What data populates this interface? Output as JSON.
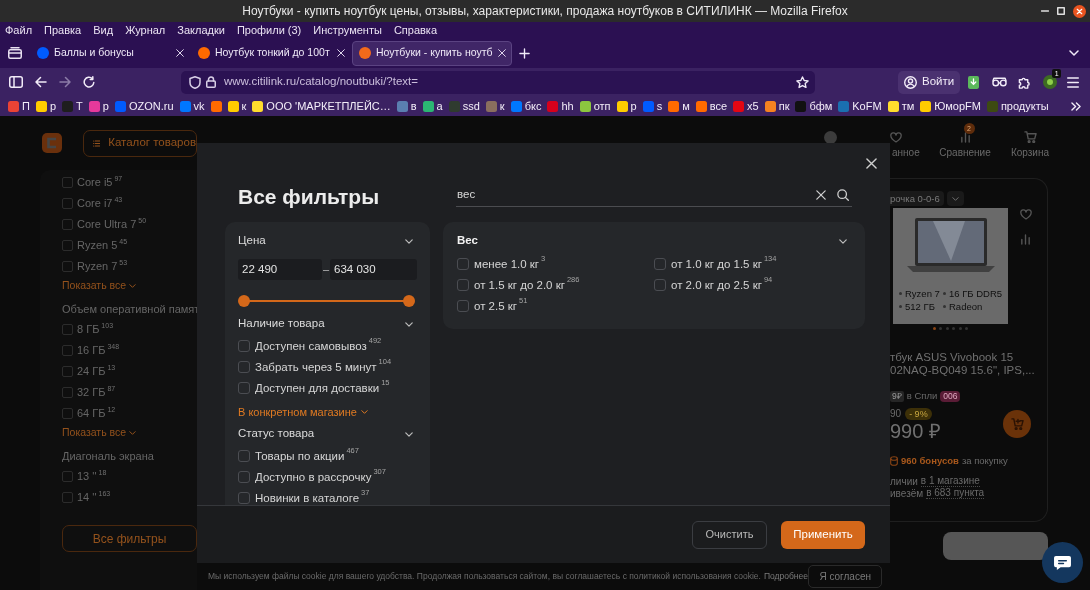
{
  "window": {
    "title": "Ноутбуки - купить ноутбук цены, отзывы, характеристики, продажа ноутбуков в СИТИЛИНК — Mozilla Firefox"
  },
  "menu_bar": [
    "Файл",
    "Правка",
    "Вид",
    "Журнал",
    "Закладки",
    "Профили (3)",
    "Инструменты",
    "Справка"
  ],
  "tabs": [
    {
      "label": "Баллы и бонусы",
      "color": "#005bff",
      "selected": false
    },
    {
      "label": "Ноутбук тонкий до 100т",
      "color": "#ff6a00",
      "selected": false
    },
    {
      "label": "Ноутбуки - купить ноутб",
      "color": "#f26a1b",
      "selected": true
    }
  ],
  "toolbar": {
    "url": "www.citilink.ru/catalog/noutbuki/?text=",
    "account_button": "Войти",
    "extension_badge": "1"
  },
  "bookmarks": [
    {
      "label": "П",
      "color": "#ea4335"
    },
    {
      "label": "р",
      "color": "#ffcc00"
    },
    {
      "label": "Т",
      "color": "#1e1e1e"
    },
    {
      "label": "р",
      "color": "#e6399b"
    },
    {
      "label": "OZON.ru",
      "color": "#005bff"
    },
    {
      "label": "vk",
      "color": "#0077ff"
    },
    {
      "color": "#ff6a00"
    },
    {
      "label": "к",
      "color": "#ffcc00"
    },
    {
      "label": "ООО 'МАРКЕТПЛЕЙС…",
      "color": "#ffdd2d"
    },
    {
      "label": "в",
      "color": "#5a7fb0"
    },
    {
      "label": "а",
      "color": "#2bb673"
    },
    {
      "label": "ssd",
      "color": "#2f3b2f"
    },
    {
      "label": "к",
      "color": "#8a6e5e"
    },
    {
      "label": "бкс",
      "color": "#0077ff"
    },
    {
      "label": "hh",
      "color": "#d6001c"
    },
    {
      "label": "отп",
      "color": "#8cc63f"
    },
    {
      "label": "р",
      "color": "#ffcc00"
    },
    {
      "label": "s",
      "color": "#005bff"
    },
    {
      "label": "м",
      "color": "#ff6a00"
    },
    {
      "label": "все",
      "color": "#ff6a00"
    },
    {
      "label": "x5",
      "color": "#e30613"
    },
    {
      "label": "пк",
      "color": "#f58220"
    },
    {
      "label": "бфм",
      "color": "#111111"
    },
    {
      "label": "KoFM",
      "color": "#1a6fb0"
    },
    {
      "label": "тм",
      "color": "#ffdd2d"
    },
    {
      "label": "ЮморFM",
      "color": "#ffcc00"
    },
    {
      "label": "продукты",
      "color": "#3d4a12"
    }
  ],
  "page": {
    "header": {
      "catalog_button": "Каталог товаров",
      "nav": [
        {
          "kind": "favorites",
          "label": "анное"
        },
        {
          "kind": "compare",
          "label": "Сравнение",
          "badge": "2"
        },
        {
          "kind": "cart",
          "label": "Корзина"
        }
      ]
    },
    "sidebar": {
      "groups": [
        {
          "options": [
            {
              "label": "Core i5",
              "count": "97",
              "checked": false
            },
            {
              "label": "Core i7",
              "count": "43",
              "checked": false
            },
            {
              "label": "Core Ultra 7",
              "count": "50",
              "checked": false
            },
            {
              "label": "Ryzen 5",
              "count": "45",
              "checked": false
            },
            {
              "label": "Ryzen 7",
              "count": "53",
              "checked": false
            }
          ],
          "show_all": "Показать все"
        },
        {
          "title": "Объем оперативной памят",
          "options": [
            {
              "label": "8 ГБ",
              "count": "103",
              "checked": false
            },
            {
              "label": "16 ГБ",
              "count": "348",
              "checked": false
            },
            {
              "label": "24 ГБ",
              "count": "13",
              "checked": false
            },
            {
              "label": "32 ГБ",
              "count": "87",
              "checked": false
            },
            {
              "label": "64 ГБ",
              "count": "12",
              "checked": false
            }
          ],
          "show_all": "Показать все"
        },
        {
          "title": "Диагональ экрана",
          "options": [
            {
              "label": "13 ''",
              "count": "18",
              "checked": false
            },
            {
              "label": "14 ''",
              "count": "163",
              "checked": false
            }
          ]
        }
      ],
      "all_filters_button": "Все фильтры"
    },
    "product": {
      "promo_label": "рочка 0-0-6",
      "specs": [
        "Ryzen 7",
        "16 ГБ DDR5",
        "512 ГБ",
        "Radeon"
      ],
      "image_dots": [
        {
          "selected": true
        },
        {
          "selected": false
        },
        {
          "selected": false
        },
        {
          "selected": false
        },
        {
          "selected": false
        },
        {
          "selected": false
        }
      ],
      "title": "тбук ASUS Vivobook 15 02NAQ-BQ049 15.6\", IPS,...",
      "split_price": "9₽",
      "split_label": "в Спли",
      "split_badge": "006",
      "old_price": "90",
      "discount": "- 9%",
      "price": "990 ₽",
      "bonus": "960 бонусов",
      "bonus_note": "за покупку",
      "availability": [
        {
          "text": "личии",
          "link": "в 1 магазине"
        },
        {
          "text": "ивезём",
          "link": "в 683 пункта"
        }
      ]
    },
    "cookie_notice": {
      "text": "Мы используем файлы cookie для вашего удобства. Продолжая пользоваться сайтом, вы соглашаетесь с политикой использования cookie.",
      "link": "Подробнее",
      "accept_button": "Я согласен"
    }
  },
  "filter_dialog": {
    "title": "Все фильтры",
    "search": {
      "value": "вес"
    },
    "left_sections": [
      {
        "kind": "price",
        "title": "Цена",
        "min_value": "22 490",
        "separator": "–",
        "max_value": "634 030",
        "slider": {
          "thumbs": [
            {
              "level": 0
            },
            {
              "level": 1
            }
          ]
        }
      },
      {
        "kind": "checklist",
        "title": "Наличие товара",
        "options": [
          {
            "label": "Доступен самовывоз",
            "count": "492",
            "checked": false
          },
          {
            "label": "Забрать через 5 минут",
            "count": "104",
            "checked": false
          },
          {
            "label": "Доступен для доставки",
            "count": "15",
            "checked": false
          }
        ],
        "link": "В конкретном магазине"
      },
      {
        "kind": "checklist",
        "title": "Статус товара",
        "options": [
          {
            "label": "Товары по акции",
            "count": "467",
            "checked": false
          },
          {
            "label": "Доступно в рассрочку",
            "count": "307",
            "checked": false
          },
          {
            "label": "Новинки в каталоге",
            "count": "37",
            "checked": false
          }
        ]
      }
    ],
    "weight_section": {
      "title": "Вес",
      "options": [
        {
          "label": "менее 1.0 кг",
          "count": "3",
          "checked": false
        },
        {
          "label": "от 1.0 кг до 1.5 кг",
          "count": "134",
          "checked": false
        },
        {
          "label": "от 1.5 кг до 2.0 кг",
          "count": "286",
          "checked": false
        },
        {
          "label": "от 2.0 кг до 2.5 кг",
          "count": "94",
          "checked": false
        },
        {
          "label": "от 2.5 кг",
          "count": "51",
          "checked": false
        }
      ]
    },
    "buttons": {
      "clear": "Очистить",
      "apply": "Применить"
    }
  }
}
